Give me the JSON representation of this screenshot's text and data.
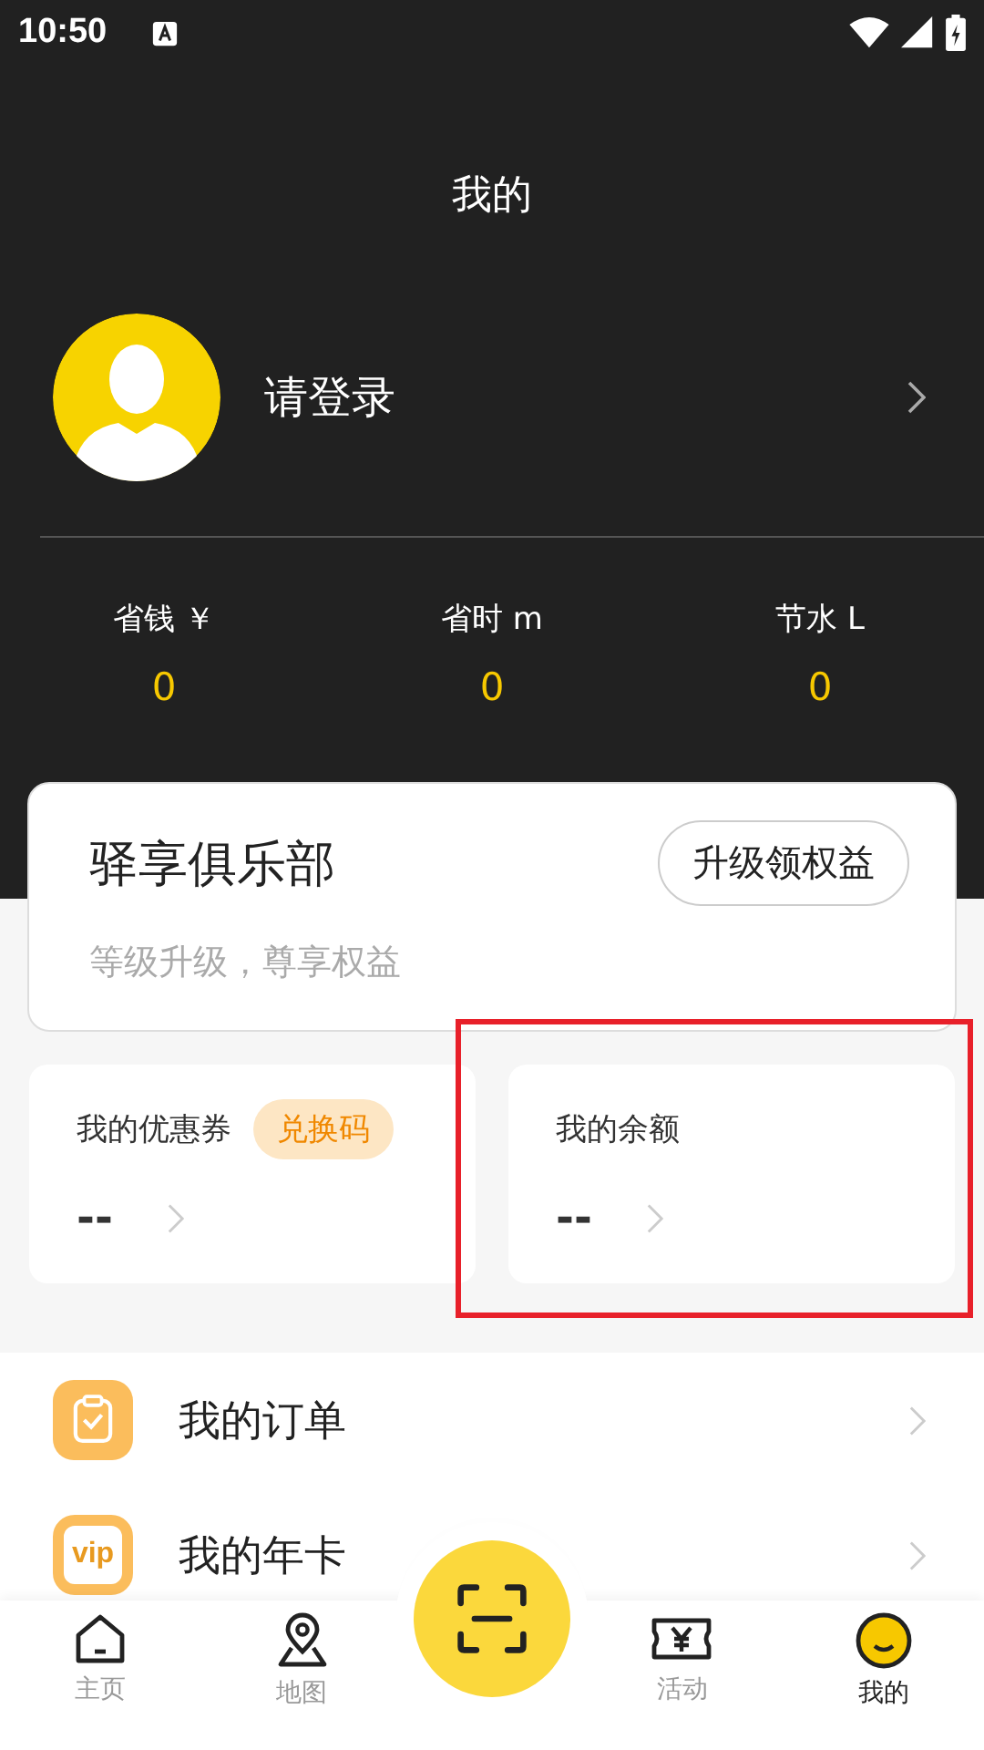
{
  "status_bar": {
    "time": "10:50"
  },
  "header": {
    "title": "我的"
  },
  "profile": {
    "name": "请登录"
  },
  "stats": [
    {
      "label": "省钱 ￥",
      "value": "0"
    },
    {
      "label": "省时 m",
      "value": "0"
    },
    {
      "label": "节水 L",
      "value": "0"
    }
  ],
  "club": {
    "title": "驿享俱乐部",
    "subtitle": "等级升级，尊享权益",
    "button": "升级领权益"
  },
  "wallet": [
    {
      "label": "我的优惠券",
      "badge": "兑换码",
      "value": "--",
      "highlighted": false
    },
    {
      "label": "我的余额",
      "value": "--",
      "highlighted": true
    }
  ],
  "menu": [
    {
      "kind": "order",
      "label": "我的订单"
    },
    {
      "kind": "vip",
      "icon_text": "vip",
      "label": "我的年卡"
    }
  ],
  "tab_bar": [
    {
      "kind": "home",
      "label": "主页",
      "selected": false
    },
    {
      "kind": "map",
      "label": "地图",
      "selected": false
    },
    {
      "kind": "scan"
    },
    {
      "kind": "activity",
      "label": "活动",
      "selected": false
    },
    {
      "kind": "me",
      "label": "我的",
      "selected": true
    }
  ]
}
